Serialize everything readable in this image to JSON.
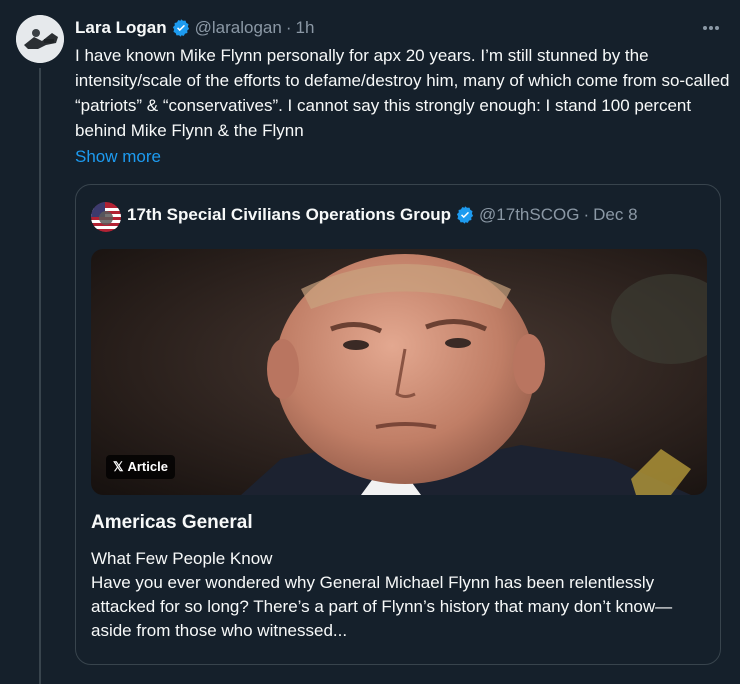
{
  "tweet": {
    "author": {
      "name": "Lara Logan",
      "handle": "@laralogan",
      "separator": "·",
      "time": "1h"
    },
    "text": "I have known Mike Flynn personally for apx 20 years. I’m still stunned by the intensity/scale of the efforts to defame/destroy him, many of which come from so-called “patriots” & “conservatives”. I cannot say this strongly enough: I stand 100 percent behind Mike Flynn & the Flynn",
    "show_more_label": "Show more",
    "more_icon": "more-horizontal-icon",
    "verified_icon": "verified-badge-icon"
  },
  "quote": {
    "author": {
      "name": "17th Special Civilians Operations Group",
      "handle": "@17thSCOG",
      "separator": "·",
      "date": "Dec 8"
    },
    "article": {
      "badge_label": "Article",
      "badge_icon": "x-logo-icon",
      "title": "Americas General",
      "subtitle": "What Few People Know",
      "excerpt": "Have you ever wondered why General Michael Flynn has been relentlessly attacked for so long? There’s a part of Flynn’s history that many don’t know—aside from those who witnessed..."
    }
  },
  "colors": {
    "background": "#15202b",
    "text": "#f7f9f9",
    "muted": "#8b98a5",
    "accent": "#1d9bf0",
    "border": "#38444d"
  }
}
